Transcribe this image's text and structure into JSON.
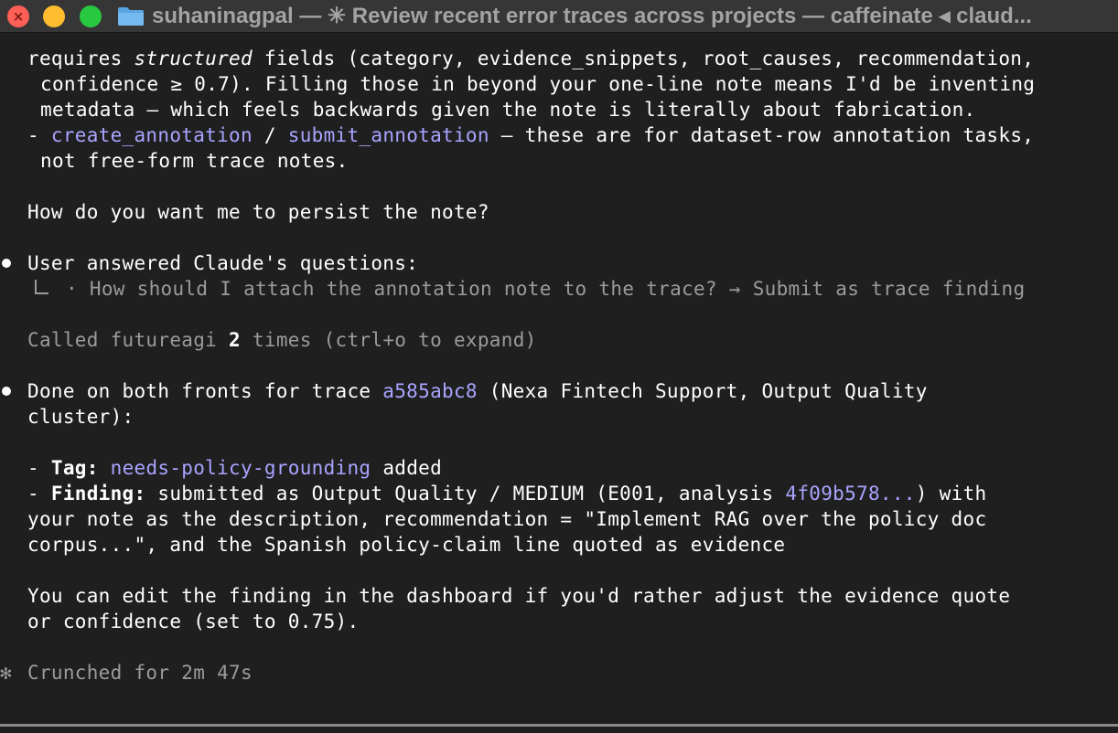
{
  "window": {
    "title": "suhaninagpal — ✳ Review recent error traces across projects — caffeinate ◂ claud..."
  },
  "transcript": {
    "l1": {
      "a": "requires ",
      "b": "structured",
      "c": " fields (category, evidence_snippets, root_causes, recommendation,"
    },
    "l2": "confidence ≥ 0.7). Filling those in beyond your one-line note means I'd be inventing",
    "l3": "metadata — which feels backwards given the note is literally about fabrication.",
    "l4": {
      "dash": "- ",
      "tool1": "create_annotation",
      "sep": " / ",
      "tool2": "submit_annotation",
      "rest": " — these are for dataset-row annotation tasks,"
    },
    "l5": "not free-form trace notes.",
    "question": "How do you want me to persist the note?",
    "user_header": "User answered Claude's questions:",
    "answer": "· How should I attach the annotation note to the trace? → Submit as trace finding",
    "called": {
      "a": "Called futureagi ",
      "count": "2",
      "c": " times (ctrl+o to expand)"
    },
    "done1": {
      "a": "Done on both fronts for trace ",
      "trace_id": "a585abc8",
      "c": " (Nexa Fintech Support, Output Quality"
    },
    "done2": "cluster):",
    "tag_line": {
      "dash": "- ",
      "label": "Tag:",
      "sp": " ",
      "tag": "needs-policy-grounding",
      "rest": " added"
    },
    "finding_line": {
      "dash": "- ",
      "label": "Finding:",
      "a": " submitted as Output Quality / MEDIUM (E001, analysis ",
      "analysis_id": "4f09b578...",
      "c": ") with"
    },
    "f2": "your note as the description, recommendation = \"Implement RAG over the policy doc",
    "f3": "corpus...\", and the Spanish policy-claim line quoted as evidence",
    "edit1": "You can edit the finding in the dashboard if you'd rather adjust the evidence quote",
    "edit2": "or confidence (set to 0.75).",
    "crunched": "Crunched for 2m 47s",
    "star": "✻"
  },
  "colors": {
    "background": "#1f1f1f",
    "text": "#ffffff",
    "muted": "#9b9b9b",
    "link": "#a9a4ff",
    "close": "#fe5f57",
    "minimize": "#febc2e",
    "maximize": "#28c840"
  },
  "icons": {
    "close": "close-icon",
    "folder": "folder-icon",
    "bullet": "bullet-dot-icon",
    "tree": "tree-branch-icon",
    "star": "asterisk-spinner-icon"
  }
}
